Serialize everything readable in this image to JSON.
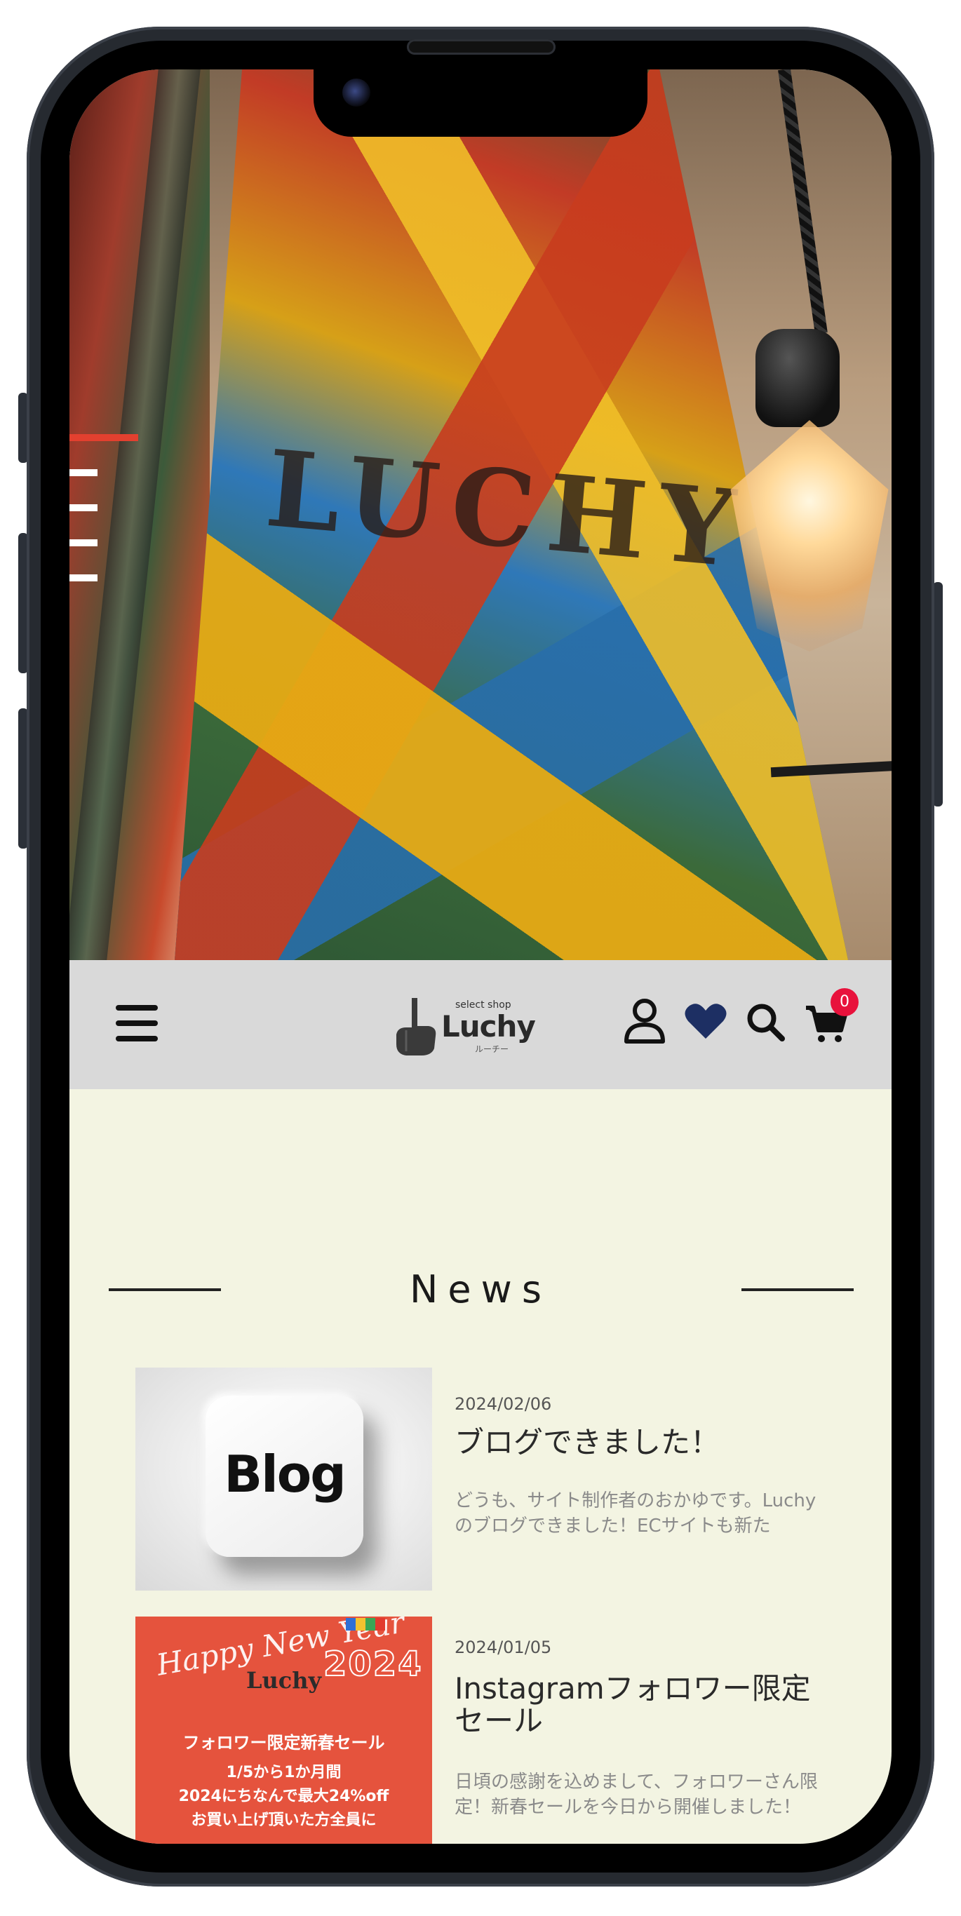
{
  "hero": {
    "stencil_text": "LUCHY"
  },
  "header": {
    "logo_small": "select shop",
    "logo_text": "Luchy",
    "logo_sub": "ルーチー",
    "cart_count": "0"
  },
  "news": {
    "title": "News",
    "articles": [
      {
        "thumb_label": "Blog",
        "date": "2024/02/06",
        "title": "ブログできました！",
        "excerpt": "どうも、サイト制作者のおかゆです。Luchyのブログできました！ECサイトも新た"
      },
      {
        "thumb_script": "Happy New Year",
        "thumb_year": "2024",
        "thumb_logo": "Luchy",
        "thumb_line1": "フォロワー限定新春セール",
        "thumb_line2": "1/5から1か月間",
        "thumb_line3": "2024にちなんで最大24%off",
        "thumb_line4": "お買い上げ頂いた方全員に",
        "date": "2024/01/05",
        "title": "Instagramフォロワー限定セール",
        "excerpt": "日頃の感謝を込めまして、フォロワーさん限定！新春セールを今日から開催しました！"
      }
    ]
  },
  "colors": {
    "accent_red": "#e8123c",
    "heart_navy": "#1d2f63",
    "header_bg": "#d9d9d9",
    "page_bg": "#f3f4e2"
  },
  "icons": [
    "menu-icon",
    "user-icon",
    "heart-icon",
    "search-icon",
    "cart-icon"
  ]
}
